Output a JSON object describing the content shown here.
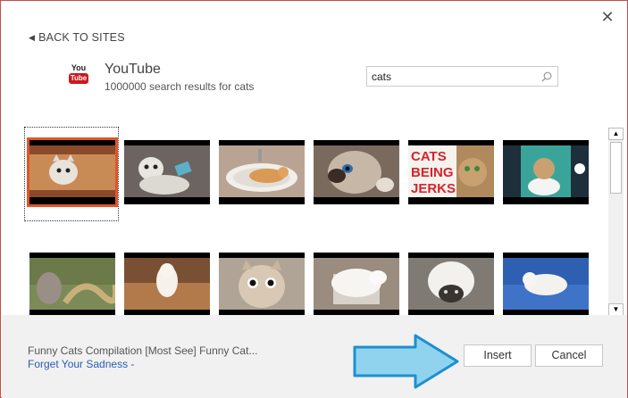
{
  "dialog": {
    "close_glyph": "✕",
    "back_label": "BACK TO SITES",
    "back_chevron": "◀"
  },
  "site": {
    "logo_you": "You",
    "logo_tube": "Tube",
    "name": "YouTube",
    "result_count": "1000000 search results for cats"
  },
  "search": {
    "value": "cats",
    "icon": "search-icon"
  },
  "thumbnails": {
    "rows": [
      [
        "cat in tube box (selected)",
        "cat with phone",
        "cat in sink",
        "cat close-up",
        "CATS BEING JERKS",
        "cat on toilet"
      ],
      [
        "cat and snake",
        "cat on floor",
        "wide-eyed kitten",
        "white cat in box",
        "cat under foam",
        "white cat on blue blanket"
      ]
    ],
    "overlay_text": [
      "CATS",
      "BEING",
      "JERKS"
    ],
    "selected_index": 0
  },
  "scrollbar": {
    "up_glyph": "▲",
    "down_glyph": "▼"
  },
  "footer": {
    "caption_title": "Funny Cats Compilation [Most See] Funny Cat...",
    "caption_sub": "Forget Your Sadness -",
    "insert_label": "Insert",
    "cancel_label": "Cancel"
  },
  "colors": {
    "selection": "#e0562a",
    "arrow_fill": "#8fd3ee",
    "arrow_stroke": "#1e8fd0",
    "link": "#2a5db0",
    "youtube_red": "#cc181e"
  }
}
